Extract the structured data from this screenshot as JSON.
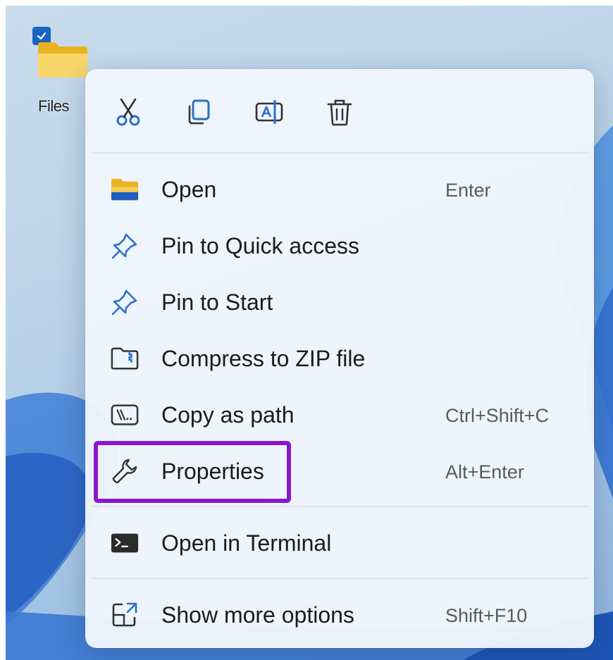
{
  "desktop": {
    "icon_label": "Files"
  },
  "toolbar": {
    "icons": [
      "cut-icon",
      "copy-icon",
      "rename-icon",
      "delete-icon"
    ]
  },
  "menu": {
    "items": [
      {
        "label": "Open",
        "shortcut": "Enter",
        "icon": "folder-icon"
      },
      {
        "label": "Pin to Quick access",
        "shortcut": "",
        "icon": "pin-icon"
      },
      {
        "label": "Pin to Start",
        "shortcut": "",
        "icon": "pin-icon"
      },
      {
        "label": "Compress to ZIP file",
        "shortcut": "",
        "icon": "zip-icon"
      },
      {
        "label": "Copy as path",
        "shortcut": "Ctrl+Shift+C",
        "icon": "path-icon"
      },
      {
        "label": "Properties",
        "shortcut": "Alt+Enter",
        "icon": "wrench-icon"
      },
      {
        "label": "Open in Terminal",
        "shortcut": "",
        "icon": "terminal-icon"
      },
      {
        "label": "Show more options",
        "shortcut": "Shift+F10",
        "icon": "show-more-icon"
      }
    ]
  },
  "colors": {
    "accent": "#1a64c4",
    "highlight_border": "#8a18c8",
    "folder_yellow": "#f5c43a"
  }
}
